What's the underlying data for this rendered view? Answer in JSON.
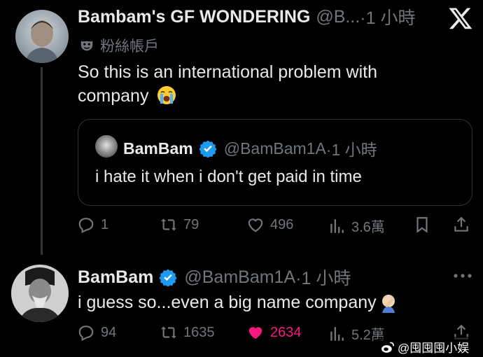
{
  "tweet1": {
    "display_name": "Bambam's GF WONDERING",
    "handle": "@B...",
    "time": "·1 小時",
    "account_label": "粉絲帳戶",
    "text_line1": "So this is an international problem with",
    "text_line2": "company",
    "emoji": "crying-face",
    "actions": {
      "replies": "1",
      "reposts": "79",
      "likes": "496",
      "views": "3.6萬"
    }
  },
  "quoted": {
    "display_name": "BamBam",
    "handle": "@BamBam1A",
    "time": "·1 小時",
    "text": "i hate it when i don't get paid in time"
  },
  "tweet2": {
    "display_name": "BamBam",
    "handle": "@BamBam1A",
    "time": "·1 小時",
    "text": "i guess so...even a big name company",
    "emoji": "facepalm",
    "actions": {
      "replies": "94",
      "reposts": "1635",
      "likes": "2634",
      "views": "5.2萬"
    }
  },
  "watermark": "@囤囤囤小娱",
  "colors": {
    "background": "#000000",
    "text": "#e7e9ea",
    "muted": "#71767b",
    "verified": "#1d9bf0",
    "liked": "#f91880",
    "border": "#2f3336"
  }
}
